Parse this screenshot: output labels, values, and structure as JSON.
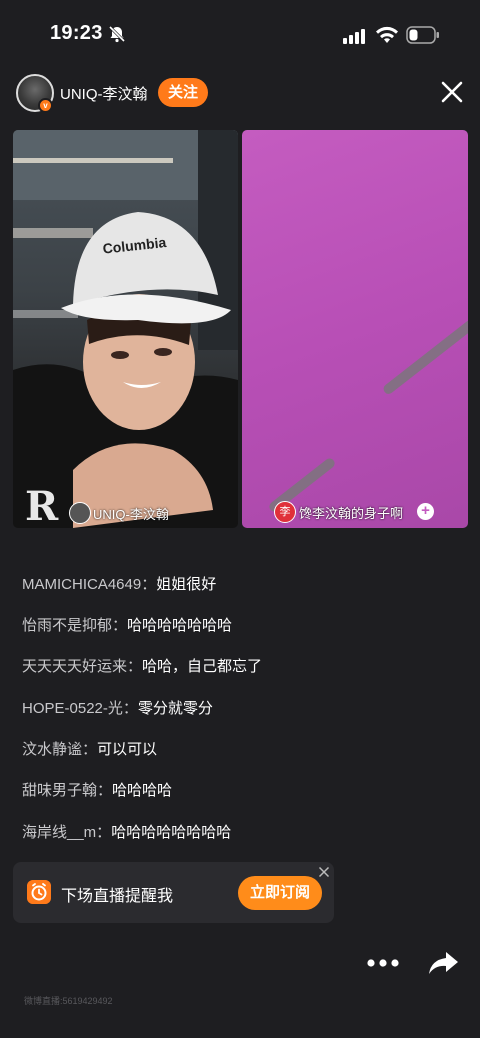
{
  "status_bar": {
    "time": "19:23",
    "icons": [
      "bell-muted-icon",
      "signal-icon",
      "wifi-icon",
      "battery-icon"
    ]
  },
  "header": {
    "host_name": "UNIQ-李汶翰",
    "follow_label": "关注",
    "verified_badge": "v",
    "close_icon": "close-icon"
  },
  "videos": {
    "left_label": "UNIQ-李汶翰",
    "right_label": "馋李汶翰的身子啊",
    "right_badge": "李"
  },
  "chat": [
    {
      "user": "MAMICHICA4649：",
      "message": "姐姐很好"
    },
    {
      "user": "怡雨不是抑郁：",
      "message": "哈哈哈哈哈哈哈"
    },
    {
      "user": "天天天天好运来：",
      "message": "哈哈，自己都忘了"
    },
    {
      "user": "HOPE-0522-光：",
      "message": "零分就零分"
    },
    {
      "user": "汶水静谧：",
      "message": "可以可以"
    },
    {
      "user": "甜味男子翰：",
      "message": "哈哈哈哈"
    },
    {
      "user": "海岸线__m：",
      "message": "哈哈哈哈哈哈哈哈"
    }
  ],
  "reminder": {
    "text": "下场直播提醒我",
    "button_label": "立即订阅"
  },
  "footer": {
    "watermark": "微博直播:5619429492"
  },
  "colors": {
    "accent": "#ff7a1a",
    "background": "#1e1e21",
    "pink_screen": "#c45cc0"
  }
}
